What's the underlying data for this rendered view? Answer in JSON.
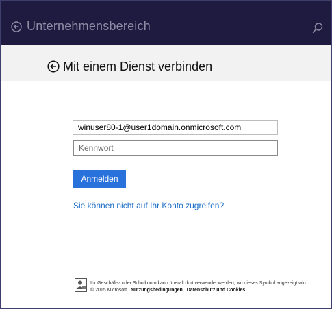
{
  "header": {
    "title": "Unternehmensbereich",
    "back_icon": "back-arrow-icon",
    "search_icon": "search-icon"
  },
  "subheader": {
    "title": "Mit einem Dienst verbinden",
    "back_icon": "back-arrow-circle-icon"
  },
  "form": {
    "email_value": "winuser80-1@user1domain.onmicrosoft.com",
    "password_placeholder": "Kennwort",
    "signin_label": "Anmelden",
    "cant_access_link": "Sie können nicht auf Ihr Konto zugreifen?"
  },
  "footer": {
    "info_text": "Ihr Geschäfts- oder Schulkonto kann überall dort verwendet werden, wo dieses Symbol angezeigt wird.",
    "copyright": "© 2015 Microsoft",
    "terms_link": "Nutzungsbedingungen",
    "privacy_link": "Datenschutz und Cookies"
  },
  "colors": {
    "topbar_bg": "#1f1a3f",
    "subheader_bg": "#f2f2f2",
    "accent": "#2a72db",
    "link": "#1c6fc7"
  }
}
